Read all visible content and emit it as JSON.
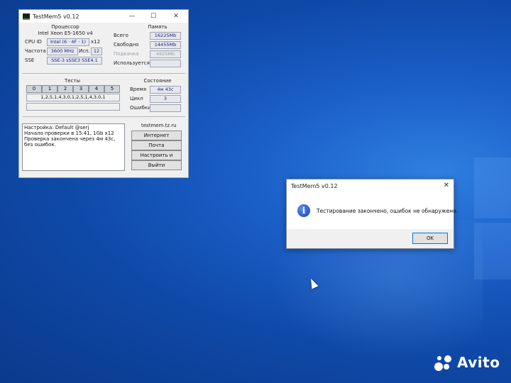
{
  "testmem": {
    "title": "TestMem5 v0.12",
    "controls": {
      "minimize": "—",
      "maximize": "☐",
      "close": "✕"
    },
    "cpu": {
      "header": "Процессор",
      "name": "Intel Xeon  E5-1650 v4",
      "cpuid_label": "CPU ID",
      "cpuid_value": "Intel  (6 · 4F · 1)",
      "threads": "x12",
      "freq_label": "Частота",
      "freq_value": "3600 MHz",
      "used_label": "Исп.",
      "used_value": "12",
      "sse_label": "SSE",
      "sse_value": "SSE-3 sSSE3 SSE4.1"
    },
    "memory": {
      "header": "Память",
      "total_label": "Всего",
      "total_value": "16225Mb",
      "free_label": "Свободно",
      "free_value": "14455Mb",
      "swap_label": "Подкачка",
      "swap_value": "4925Mb",
      "used_label": "Используется",
      "used_value": ""
    },
    "tests": {
      "header": "Тесты",
      "indices": [
        "0",
        "1",
        "2",
        "3",
        "4",
        "5"
      ],
      "sequence": "1,2,5,1,4,3,0,1,2,5,1,4,3,0,1"
    },
    "status": {
      "header": "Состояние",
      "time_label": "Время",
      "time_value": "4м 43с",
      "cycle_label": "Цикл",
      "cycle_value": "3",
      "errors_label": "Ошибки",
      "errors_value": ""
    },
    "log_lines": [
      "Настройка: Default @serj",
      "Начало проверки в 15:41, 1Gb x12",
      "Проверка закончена через 4м 43с,",
      "без ошибок."
    ],
    "site": "testmem.tz.ru",
    "buttons": {
      "internet": "Интернет",
      "mail": "Почта",
      "setup_exit": "Настроить и выйти",
      "exit": "Выйти"
    }
  },
  "dialog": {
    "title": "TestMem5 v0.12",
    "close": "✕",
    "message": "Тестирование закончено, ошибок не обнаружено.",
    "icon": "i",
    "ok": "OK"
  },
  "watermark": {
    "text": "Avito"
  }
}
